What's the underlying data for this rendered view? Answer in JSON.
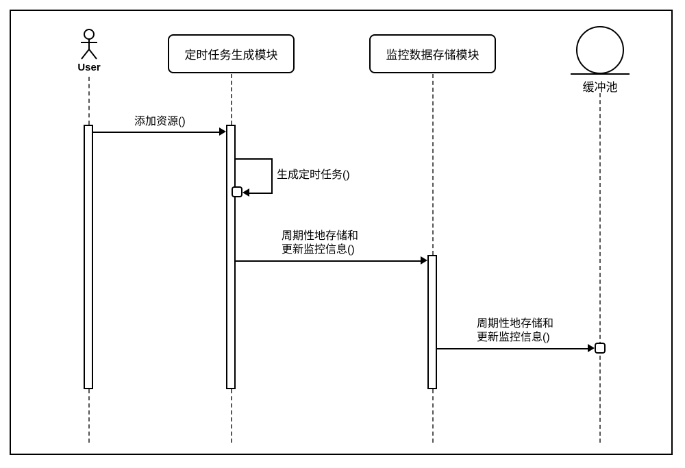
{
  "lifelines": {
    "user": {
      "label": "User"
    },
    "timerModule": {
      "label": "定时任务生成模块"
    },
    "storageModule": {
      "label": "监控数据存储模块"
    },
    "bufferPool": {
      "label": "缓冲池"
    }
  },
  "messages": {
    "addResource": {
      "label": "添加资源()"
    },
    "genTimerTask": {
      "label": "生成定时任务()"
    },
    "periodicStoreUpdate1": {
      "line1": "周期性地存储和",
      "line2": "更新监控信息()"
    },
    "periodicStoreUpdate2": {
      "line1": "周期性地存储和",
      "line2": "更新监控信息()"
    }
  },
  "chart_data": {
    "type": "table",
    "title": "UML Sequence Diagram",
    "lifelines": [
      {
        "id": "user",
        "label": "User",
        "kind": "actor"
      },
      {
        "id": "timerModule",
        "label": "定时任务生成模块",
        "kind": "component"
      },
      {
        "id": "storageModule",
        "label": "监控数据存储模块",
        "kind": "component"
      },
      {
        "id": "bufferPool",
        "label": "缓冲池",
        "kind": "entity"
      }
    ],
    "messages": [
      {
        "from": "user",
        "to": "timerModule",
        "label": "添加资源()",
        "type": "sync"
      },
      {
        "from": "timerModule",
        "to": "timerModule",
        "label": "生成定时任务()",
        "type": "self"
      },
      {
        "from": "timerModule",
        "to": "storageModule",
        "label": "周期性地存储和更新监控信息()",
        "type": "sync"
      },
      {
        "from": "storageModule",
        "to": "bufferPool",
        "label": "周期性地存储和更新监控信息()",
        "type": "sync"
      }
    ]
  }
}
